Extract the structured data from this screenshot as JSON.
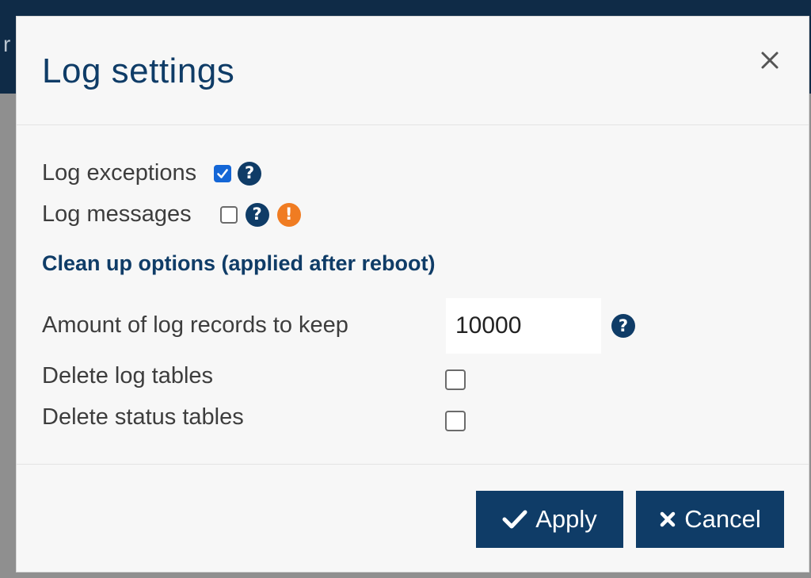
{
  "background": {
    "partial_letter": "r"
  },
  "dialog": {
    "title": "Log settings",
    "close_glyph": "×",
    "options": [
      {
        "label": "Log exceptions",
        "checked": true,
        "help_icon": "question-circle-icon"
      },
      {
        "label": "Log messages",
        "checked": false,
        "help_icon": "question-circle-icon",
        "warning_icon": "exclamation-circle-icon"
      }
    ],
    "cleanup": {
      "title": "Clean up options (applied after reboot)",
      "records_label": "Amount of log records to keep",
      "records_value": "10000",
      "delete_log_tables_label": "Delete log tables",
      "delete_log_tables_checked": false,
      "delete_status_tables_label": "Delete status tables",
      "delete_status_tables_checked": false
    },
    "buttons": {
      "apply_label": "Apply",
      "cancel_label": "Cancel"
    }
  },
  "colors": {
    "primary": "#0f3c67",
    "checkbox_checked": "#1466d6",
    "warning": "#f07c22"
  }
}
